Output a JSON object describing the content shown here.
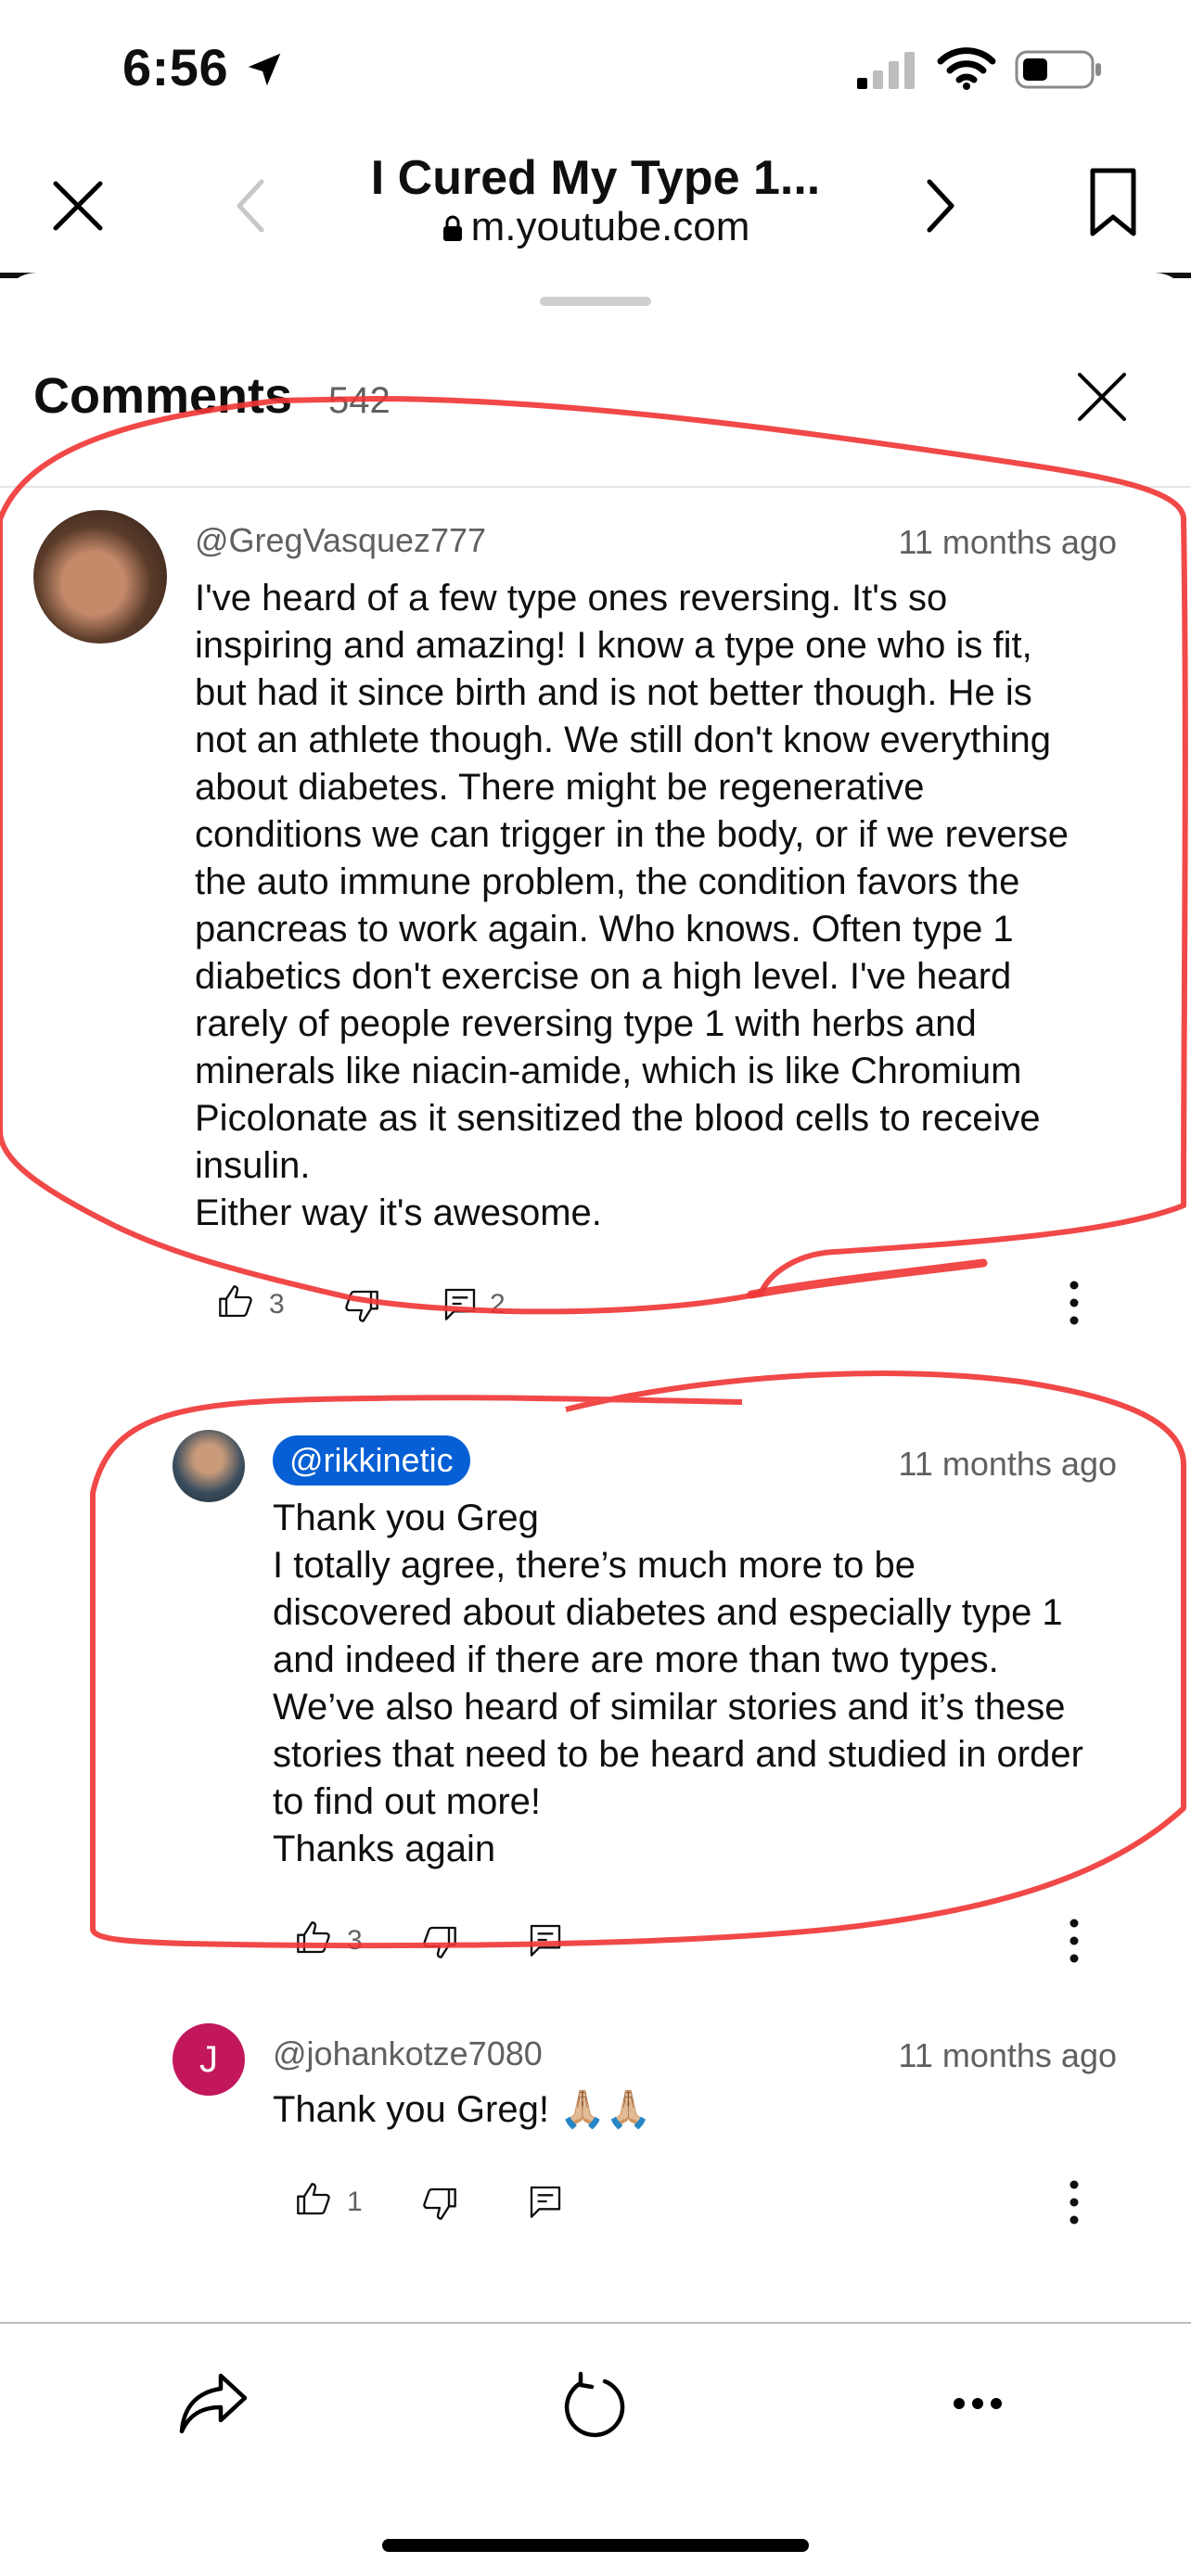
{
  "status_bar": {
    "time": "6:56"
  },
  "browser": {
    "title": "I Cured My Type 1...",
    "url": "m.youtube.com"
  },
  "comments": {
    "title": "Comments",
    "count": "542",
    "items": [
      {
        "author": "@GregVasquez777",
        "time": "11 months ago",
        "text": "I've heard of a few type ones reversing. It's so\ninspiring and amazing! I know a type one who is fit,\nbut had it since birth and is not better though. He is\nnot an athlete though. We still don't know everything\nabout diabetes. There might be regenerative\nconditions we can trigger in the body, or if we reverse\nthe auto immune problem, the condition favors the\npancreas to work again. Who knows. Often type 1\ndiabetics don't exercise on a high level. I've heard\nrarely of people reversing type 1 with herbs and\nminerals like niacin-amide, which is like Chromium\nPicolonate as it sensitized the blood cells to receive\ninsulin.\nEither way it's awesome.",
        "likes": "3",
        "replies": "2"
      },
      {
        "author": "@rikkinetic",
        "time": "11 months ago",
        "text": "Thank you Greg\nI totally agree, there’s much more to be\ndiscovered about diabetes and especially type 1\nand indeed if there are more than two types.\nWe’ve also heard of similar stories and it’s these\nstories that need to be heard and studied in order\nto find out more!\nThanks again",
        "likes": "3"
      },
      {
        "author": "@johankotze7080",
        "avatar_letter": "J",
        "time": "11 months ago",
        "text": "Thank you Greg! 🙏🏼🙏🏼",
        "likes": "1"
      }
    ]
  },
  "colors": {
    "accent_blue": "#065fd4",
    "avatar_j": "#c2185b",
    "annotation_red": "#f03434"
  },
  "icons": [
    "close-icon",
    "back-chevron-icon",
    "forward-chevron-icon",
    "bookmark-icon",
    "lock-icon",
    "like-icon",
    "dislike-icon",
    "reply-icon",
    "more-vert-icon",
    "share-icon",
    "reload-icon",
    "more-horiz-icon",
    "signal-icon",
    "wifi-icon",
    "battery-icon",
    "location-arrow-icon"
  ]
}
